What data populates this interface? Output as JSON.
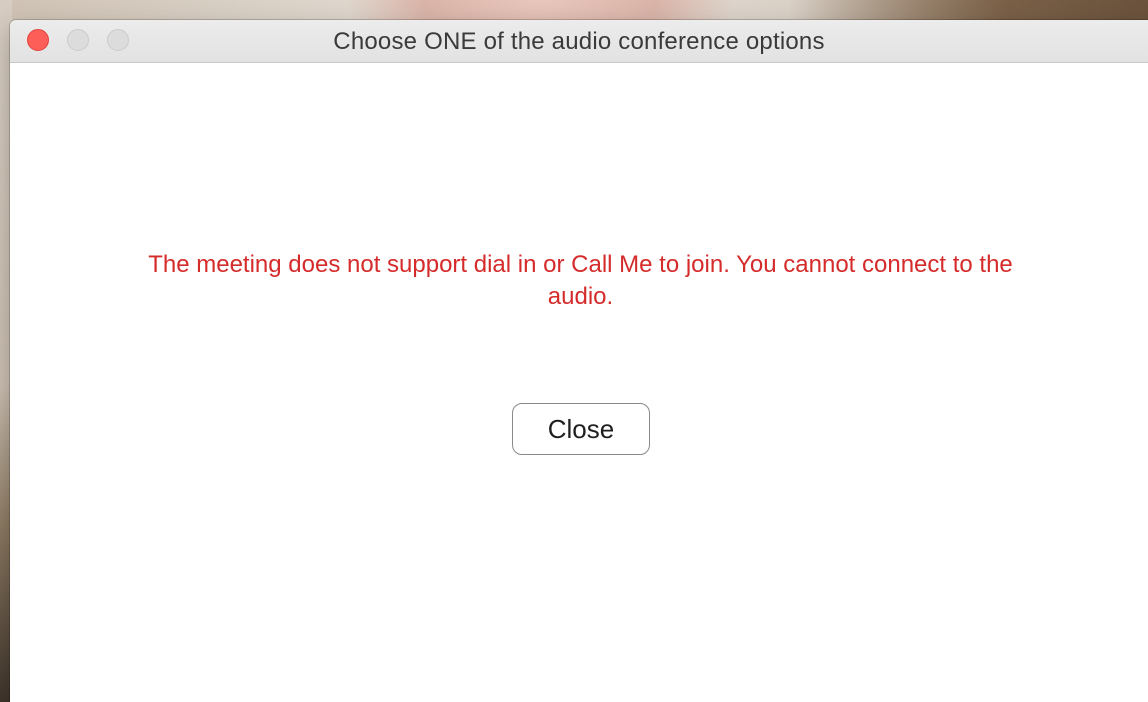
{
  "window": {
    "title": "Choose ONE of the audio conference options",
    "traffic_lights": {
      "close_color": "#fd5e57",
      "minimize_color": "#dcdcdc",
      "maximize_color": "#dcdcdc"
    }
  },
  "dialog": {
    "message": "The meeting does not support dial in or Call Me to join. You cannot connect to the audio.",
    "message_color": "#d52b2b",
    "close_button_label": "Close"
  }
}
